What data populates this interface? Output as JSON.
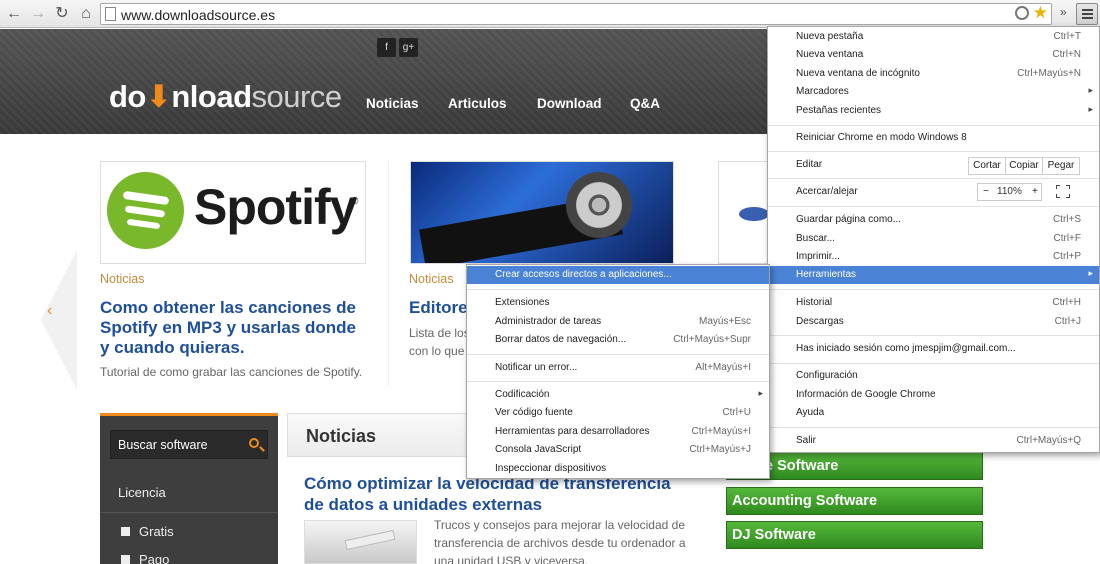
{
  "browser": {
    "url": "www.downloadsource.es"
  },
  "site": {
    "social": [
      "f",
      "g+"
    ],
    "logo": {
      "part1": "do",
      "part2": "nload",
      "part3": "source"
    },
    "nav": [
      "Noticias",
      "Articulos",
      "Download",
      "Q&A"
    ],
    "slider_arrow": "‹",
    "cards": [
      {
        "image_text": "Spotify",
        "image_reg": "®",
        "category": "Noticias",
        "title": "Como obtener las canciones de Spotify en MP3 y usarlas donde y cuando quieras.",
        "description": "Tutorial de como grabar las canciones de Spotify."
      },
      {
        "category": "Noticias",
        "title": "Editores",
        "description_line1": "Lista de los",
        "description_line2": "con lo que"
      }
    ],
    "sidebar": {
      "search_label": "Buscar software",
      "licencia_label": "Licencia",
      "options": [
        "Gratis",
        "Pago"
      ]
    },
    "news": {
      "header": "Noticias",
      "article_title": "Cómo optimizar la velocidad de transferencia de datos a unidades externas",
      "article_desc": "Trucos y consejos para mejorar la velocidad de transferencia de archivos desde tu ordenador a una unidad USB y viceversa."
    },
    "categories": [
      "Office Software",
      "Accounting Software",
      "DJ Software"
    ]
  },
  "chrome_menu": {
    "items": [
      {
        "label": "Nueva pestaña",
        "shortcut": "Ctrl+T"
      },
      {
        "label": "Nueva ventana",
        "shortcut": "Ctrl+N"
      },
      {
        "label": "Nueva ventana de incógnito",
        "shortcut": "Ctrl+Mayús+N"
      },
      {
        "label": "Marcadores",
        "arrow": "▸"
      },
      {
        "label": "Pestañas recientes",
        "arrow": "▸"
      },
      {
        "label": "Reiniciar Chrome en modo Windows 8"
      },
      {
        "label": "Editar"
      },
      {
        "label": "Acercar/alejar"
      },
      {
        "label": "Guardar página como...",
        "shortcut": "Ctrl+S"
      },
      {
        "label": "Buscar...",
        "shortcut": "Ctrl+F"
      },
      {
        "label": "Imprimir...",
        "shortcut": "Ctrl+P"
      },
      {
        "label": "Herramientas",
        "arrow": "▸"
      },
      {
        "label": "Historial",
        "shortcut": "Ctrl+H"
      },
      {
        "label": "Descargas",
        "shortcut": "Ctrl+J"
      },
      {
        "label": "Has iniciado sesión como jmespjim@gmail.com..."
      },
      {
        "label": "Configuración"
      },
      {
        "label": "Información de Google Chrome"
      },
      {
        "label": "Ayuda"
      },
      {
        "label": "Salir",
        "shortcut": "Ctrl+Mayús+Q"
      }
    ],
    "edit_buttons": [
      "Cortar",
      "Copiar",
      "Pegar"
    ],
    "zoom": {
      "minus": "−",
      "value": "110%",
      "plus": "+"
    }
  },
  "tools_submenu": {
    "items": [
      {
        "label": "Crear accesos directos a aplicaciones..."
      },
      {
        "label": "Extensiones"
      },
      {
        "label": "Administrador de tareas",
        "shortcut": "Mayús+Esc"
      },
      {
        "label": "Borrar datos de navegación...",
        "shortcut": "Ctrl+Mayús+Supr"
      },
      {
        "label": "Notificar un error...",
        "shortcut": "Alt+Mayús+I"
      },
      {
        "label": "Codificación",
        "arrow": "▸"
      },
      {
        "label": "Ver código fuente",
        "shortcut": "Ctrl+U"
      },
      {
        "label": "Herramientas para desarrolladores",
        "shortcut": "Ctrl+Mayús+I"
      },
      {
        "label": "Consola JavaScript",
        "shortcut": "Ctrl+Mayús+J"
      },
      {
        "label": "Inspeccionar dispositivos"
      }
    ]
  }
}
